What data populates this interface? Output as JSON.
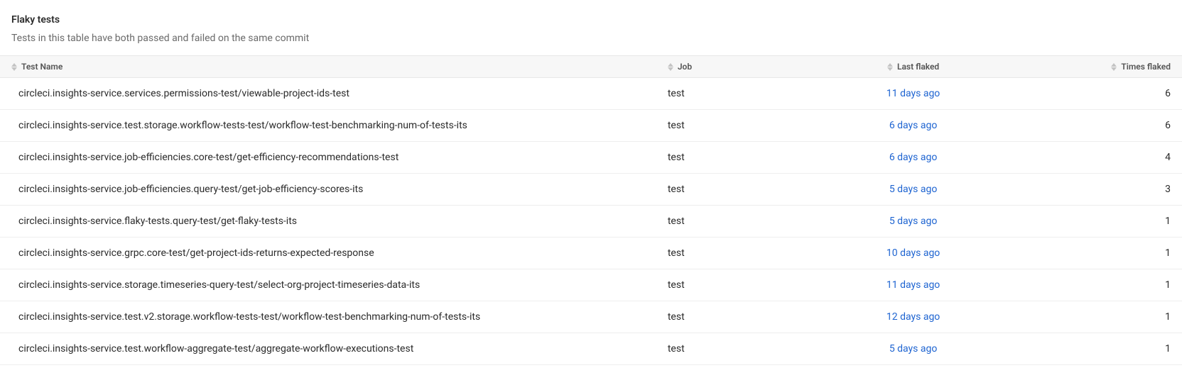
{
  "header": {
    "title": "Flaky tests",
    "subtitle": "Tests in this table have both passed and failed on the same commit"
  },
  "columns": {
    "test_name": "Test Name",
    "job": "Job",
    "last_flaked": "Last flaked",
    "times_flaked": "Times flaked"
  },
  "rows": [
    {
      "test_name": "circleci.insights-service.services.permissions-test/viewable-project-ids-test",
      "job": "test",
      "last_flaked": "11 days ago",
      "times_flaked": "6"
    },
    {
      "test_name": "circleci.insights-service.test.storage.workflow-tests-test/workflow-test-benchmarking-num-of-tests-its",
      "job": "test",
      "last_flaked": "6 days ago",
      "times_flaked": "6"
    },
    {
      "test_name": "circleci.insights-service.job-efficiencies.core-test/get-efficiency-recommendations-test",
      "job": "test",
      "last_flaked": "6 days ago",
      "times_flaked": "4"
    },
    {
      "test_name": "circleci.insights-service.job-efficiencies.query-test/get-job-efficiency-scores-its",
      "job": "test",
      "last_flaked": "5 days ago",
      "times_flaked": "3"
    },
    {
      "test_name": "circleci.insights-service.flaky-tests.query-test/get-flaky-tests-its",
      "job": "test",
      "last_flaked": "5 days ago",
      "times_flaked": "1"
    },
    {
      "test_name": "circleci.insights-service.grpc.core-test/get-project-ids-returns-expected-response",
      "job": "test",
      "last_flaked": "10 days ago",
      "times_flaked": "1"
    },
    {
      "test_name": "circleci.insights-service.storage.timeseries-query-test/select-org-project-timeseries-data-its",
      "job": "test",
      "last_flaked": "11 days ago",
      "times_flaked": "1"
    },
    {
      "test_name": "circleci.insights-service.test.v2.storage.workflow-tests-test/workflow-test-benchmarking-num-of-tests-its",
      "job": "test",
      "last_flaked": "12 days ago",
      "times_flaked": "1"
    },
    {
      "test_name": "circleci.insights-service.test.workflow-aggregate-test/aggregate-workflow-executions-test",
      "job": "test",
      "last_flaked": "5 days ago",
      "times_flaked": "1"
    }
  ]
}
